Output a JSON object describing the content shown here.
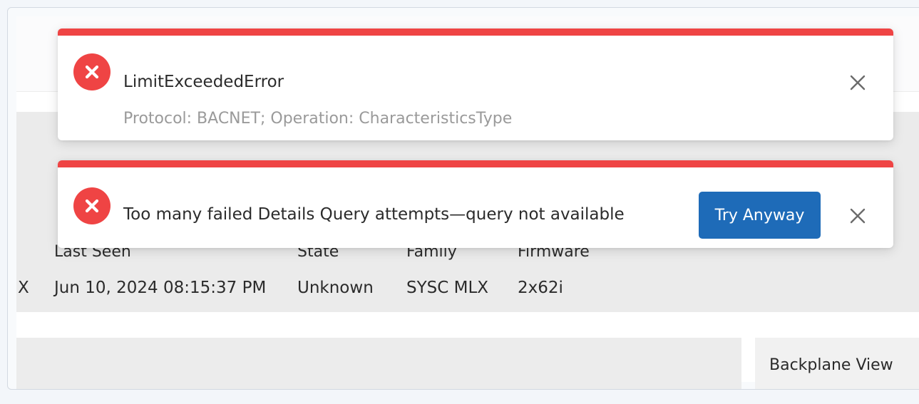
{
  "device_row": {
    "col0_tail": "X",
    "last_seen": "Jun 10, 2024 08:15:37 PM",
    "state": "Unknown",
    "family": "SYSC MLX",
    "firmware": "2x62i"
  },
  "device_headers": {
    "last_seen": "Last Seen",
    "state": "State",
    "family": "Family",
    "firmware": "Firmware"
  },
  "panels": {
    "backplane_label": "Backplane View"
  },
  "toasts": [
    {
      "title": "LimitExceededError",
      "subtitle": "Protocol: BACNET; Operation: CharacteristicsType",
      "icon": "error-circle-icon",
      "close_icon": "close-icon"
    },
    {
      "message": "Too many failed Details Query attempts—query not available",
      "action_label": "Try Anyway",
      "icon": "error-circle-icon",
      "close_icon": "close-icon"
    }
  ],
  "colors": {
    "error": "#ef4444",
    "primary": "#1e6bb8"
  }
}
